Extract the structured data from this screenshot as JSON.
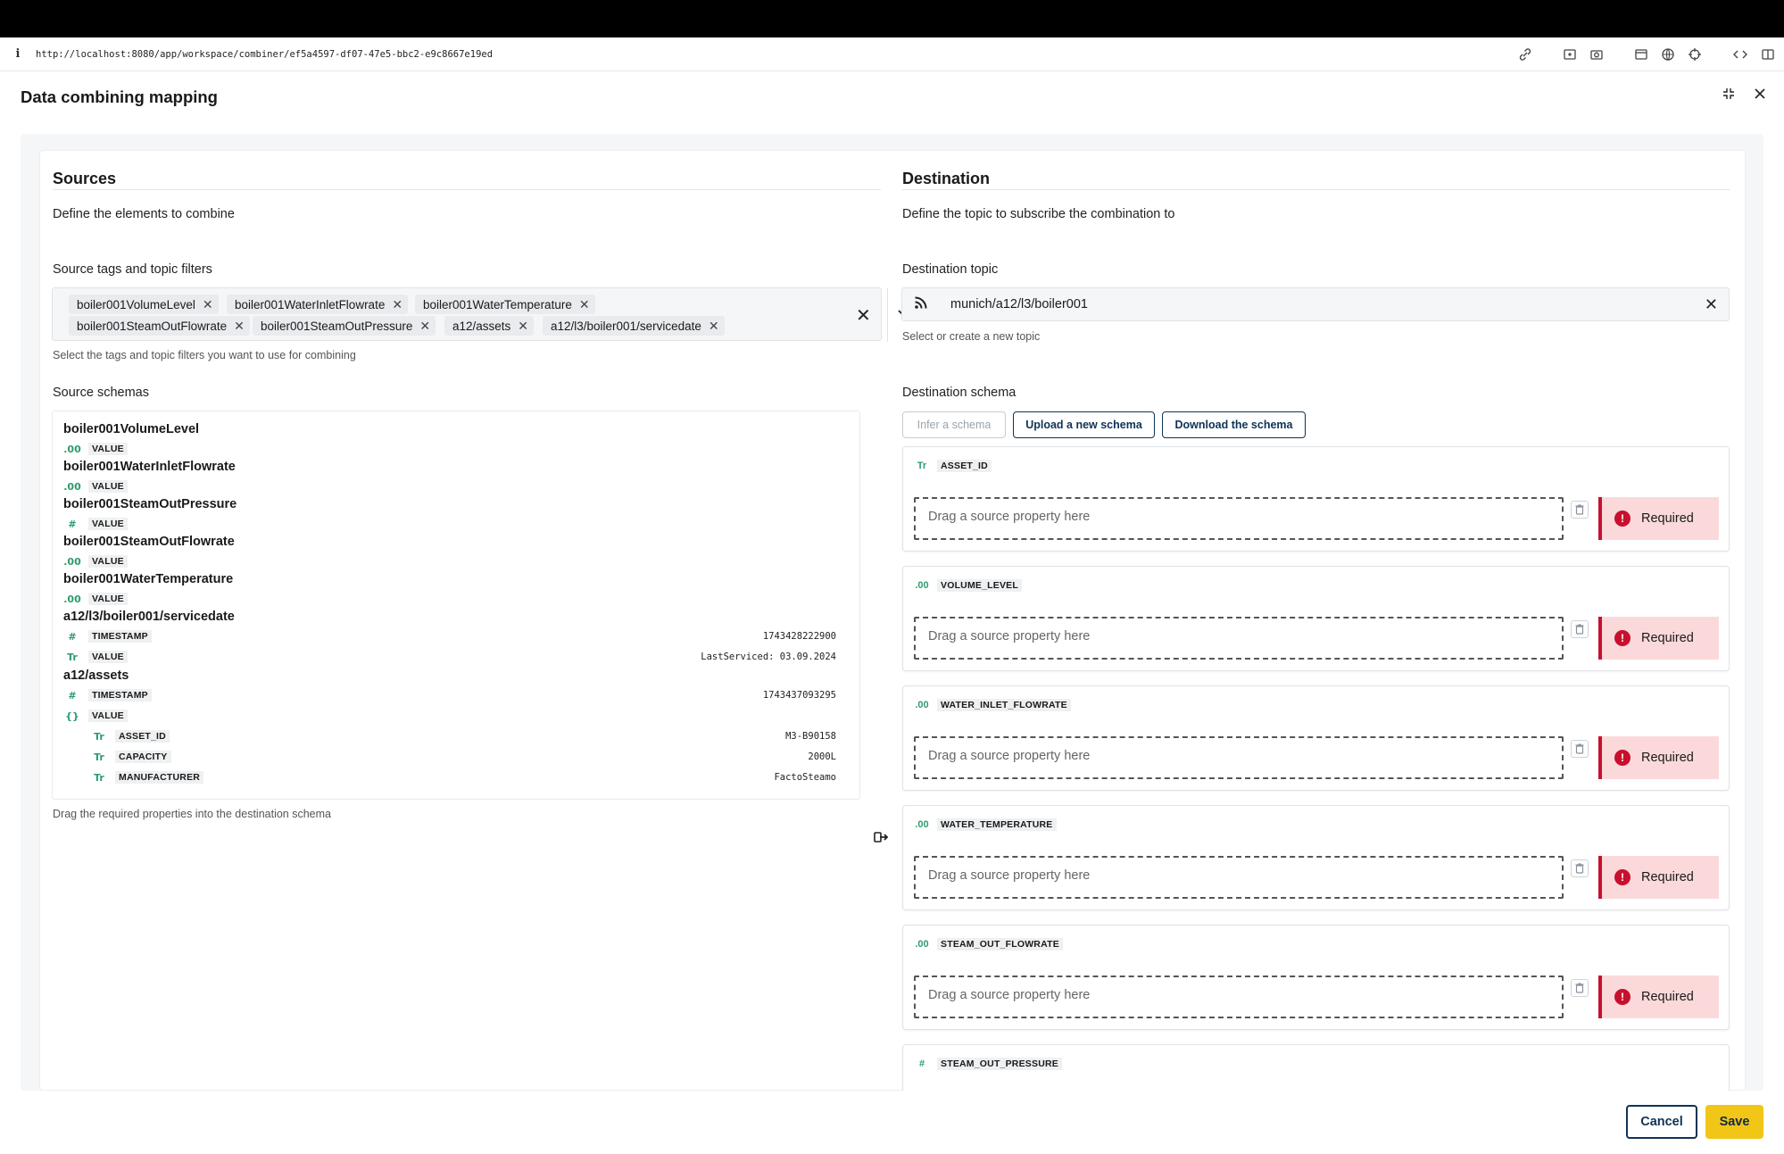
{
  "browser": {
    "url": "http://localhost:8080/app/workspace/combiner/ef5a4597-df07-47e5-bbc2-e9c8667e19ed",
    "info_icon": "info-icon"
  },
  "dialog": {
    "title": "Data combining mapping"
  },
  "sources": {
    "title": "Sources",
    "description": "Define the elements to combine",
    "tags_label": "Source tags and topic filters",
    "tags": [
      "boiler001VolumeLevel",
      "boiler001WaterInletFlowrate",
      "boiler001WaterTemperature",
      "boiler001SteamOutFlowrate",
      "boiler001SteamOutPressure",
      "a12/assets",
      "a12/l3/boiler001/servicedate"
    ],
    "tags_helper": "Select the tags and topic filters you want to use for combining",
    "schemas_label": "Source schemas",
    "schemas": [
      {
        "name": "boiler001VolumeLevel",
        "props": [
          {
            "type": ".00",
            "name": "VALUE",
            "value": ""
          }
        ]
      },
      {
        "name": "boiler001WaterInletFlowrate",
        "props": [
          {
            "type": ".00",
            "name": "VALUE",
            "value": ""
          }
        ]
      },
      {
        "name": "boiler001SteamOutPressure",
        "props": [
          {
            "type": "#",
            "name": "VALUE",
            "value": ""
          }
        ]
      },
      {
        "name": "boiler001SteamOutFlowrate",
        "props": [
          {
            "type": ".00",
            "name": "VALUE",
            "value": ""
          }
        ]
      },
      {
        "name": "boiler001WaterTemperature",
        "props": [
          {
            "type": ".00",
            "name": "VALUE",
            "value": ""
          }
        ]
      },
      {
        "name": "a12/l3/boiler001/servicedate",
        "props": [
          {
            "type": "#",
            "name": "TIMESTAMP",
            "value": "1743428222900"
          },
          {
            "type": "Tr",
            "name": "VALUE",
            "value": "LastServiced: 03.09.2024"
          }
        ]
      },
      {
        "name": "a12/assets",
        "props": [
          {
            "type": "#",
            "name": "TIMESTAMP",
            "value": "1743437093295"
          },
          {
            "type": "{}",
            "name": "VALUE",
            "value": ""
          },
          {
            "type": "Tr",
            "name": "ASSET_ID",
            "value": "M3-B90158"
          },
          {
            "type": "Tr",
            "name": "CAPACITY",
            "value": "2000L"
          },
          {
            "type": "Tr",
            "name": "MANUFACTURER",
            "value": "FactoSteamo"
          }
        ]
      }
    ],
    "schemas_helper": "Drag the required properties into the destination schema"
  },
  "destination": {
    "title": "Destination",
    "description": "Define the topic to subscribe the combination to",
    "topic_label": "Destination topic",
    "topic_value": "munich/a12/l3/boiler001",
    "topic_helper": "Select or create a new topic",
    "schema_label": "Destination schema",
    "buttons": {
      "infer": "Infer a schema",
      "upload": "Upload a new schema",
      "download": "Download the schema"
    },
    "drop_placeholder": "Drag a source property here",
    "required_label": "Required",
    "properties": [
      {
        "type": "Tr",
        "name": "ASSET_ID"
      },
      {
        "type": ".00",
        "name": "VOLUME_LEVEL"
      },
      {
        "type": ".00",
        "name": "WATER_INLET_FLOWRATE"
      },
      {
        "type": ".00",
        "name": "WATER_TEMPERATURE"
      },
      {
        "type": ".00",
        "name": "STEAM_OUT_FLOWRATE"
      },
      {
        "type": "#",
        "name": "STEAM_OUT_PRESSURE"
      }
    ]
  },
  "footer": {
    "cancel": "Cancel",
    "save": "Save"
  },
  "colors": {
    "accent_navy": "#0f3356",
    "save_yellow": "#f2c617",
    "required_red": "#c8102e",
    "required_bg": "#fbd9da",
    "type_green": "#2e9b6e"
  }
}
